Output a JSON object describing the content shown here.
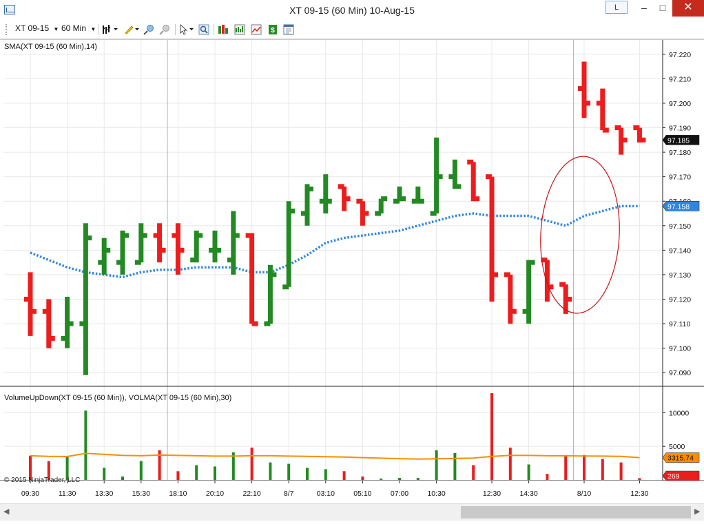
{
  "window": {
    "title": "XT 09-15 (60 Min)  10-Aug-15",
    "link_button_label": "L",
    "minimize_glyph": "–",
    "maximize_glyph": "□",
    "close_glyph": "✕"
  },
  "toolbar": {
    "instrument": "XT 09-15",
    "interval": "60 Min",
    "icons": [
      "bar-type-icon",
      "drawing-pencil-icon",
      "zoom-in-icon",
      "zoom-out-icon",
      "pointer-icon",
      "search-icon",
      "strategies-icon",
      "chart-style-icon",
      "indicators-icon",
      "money-icon",
      "properties-icon"
    ]
  },
  "colors": {
    "up": "#238a23",
    "down": "#ee1c1c",
    "sma": "#2f86e0",
    "volma": "#ff8c00",
    "ellipse": "#cc1111",
    "grid": "#e8e8e8"
  },
  "price_panel": {
    "label": "SMA(XT 09-15 (60 Min),14)",
    "y_ticks": [
      "97.220",
      "97.210",
      "97.200",
      "97.190",
      "97.180",
      "97.170",
      "97.160",
      "97.150",
      "97.140",
      "97.130",
      "97.120",
      "97.110",
      "97.100",
      "97.090"
    ],
    "last_price": "97.185",
    "sma_value": "97.158"
  },
  "volume_panel": {
    "label": "VolumeUpDown(XT 09-15 (60 Min)), VOLMA(XT 09-15 (60 Min),30)",
    "y_ticks": [
      "10000",
      "5000"
    ],
    "volma_value": "3315.74",
    "last_volume": "269"
  },
  "copyright": "© 2015 NinjaTrader, LLC",
  "x_ticks": [
    "09:30",
    "11:30",
    "13:30",
    "15:30",
    "18:10",
    "20:10",
    "22:10",
    "8/7",
    "03:10",
    "05:10",
    "07:00",
    "10:30",
    "12:30",
    "14:30",
    "8/10",
    "12:30"
  ],
  "chart_data": {
    "type": "bar",
    "bars": [
      {
        "dir": "down",
        "open": 97.12,
        "high": 97.131,
        "low": 97.105,
        "close": 97.115
      },
      {
        "dir": "down",
        "open": 97.115,
        "high": 97.12,
        "low": 97.1,
        "close": 97.104
      },
      {
        "dir": "up",
        "open": 97.104,
        "high": 97.121,
        "low": 97.1,
        "close": 97.11
      },
      {
        "dir": "up",
        "open": 97.11,
        "high": 97.151,
        "low": 97.089,
        "close": 97.145
      },
      {
        "dir": "up",
        "open": 97.135,
        "high": 97.145,
        "low": 97.13,
        "close": 97.14
      },
      {
        "dir": "up",
        "open": 97.135,
        "high": 97.148,
        "low": 97.13,
        "close": 97.146
      },
      {
        "dir": "up",
        "open": 97.135,
        "high": 97.151,
        "low": 97.135,
        "close": 97.146
      },
      {
        "dir": "down",
        "open": 97.146,
        "high": 97.151,
        "low": 97.135,
        "close": 97.14
      },
      {
        "dir": "down",
        "open": 97.146,
        "high": 97.151,
        "low": 97.13,
        "close": 97.14
      },
      {
        "dir": "up",
        "open": 97.136,
        "high": 97.148,
        "low": 97.135,
        "close": 97.146
      },
      {
        "dir": "up",
        "open": 97.14,
        "high": 97.148,
        "low": 97.135,
        "close": 97.14
      },
      {
        "dir": "up",
        "open": 97.136,
        "high": 97.156,
        "low": 97.13,
        "close": 97.146
      },
      {
        "dir": "down",
        "open": 97.146,
        "high": 97.147,
        "low": 97.11,
        "close": 97.11
      },
      {
        "dir": "up",
        "open": 97.11,
        "high": 97.134,
        "low": 97.11,
        "close": 97.13
      },
      {
        "dir": "up",
        "open": 97.125,
        "high": 97.16,
        "low": 97.125,
        "close": 97.156
      },
      {
        "dir": "up",
        "open": 97.155,
        "high": 97.167,
        "low": 97.15,
        "close": 97.165
      },
      {
        "dir": "up",
        "open": 97.16,
        "high": 97.171,
        "low": 97.155,
        "close": 97.16
      },
      {
        "dir": "down",
        "open": 97.166,
        "high": 97.166,
        "low": 97.156,
        "close": 97.161
      },
      {
        "dir": "down",
        "open": 97.16,
        "high": 97.16,
        "low": 97.15,
        "close": 97.155
      },
      {
        "dir": "up",
        "open": 97.155,
        "high": 97.161,
        "low": 97.155,
        "close": 97.161
      },
      {
        "dir": "up",
        "open": 97.16,
        "high": 97.166,
        "low": 97.16,
        "close": 97.161
      },
      {
        "dir": "up",
        "open": 97.16,
        "high": 97.166,
        "low": 97.16,
        "close": 97.16
      },
      {
        "dir": "up",
        "open": 97.155,
        "high": 97.186,
        "low": 97.155,
        "close": 97.17
      },
      {
        "dir": "up",
        "open": 97.17,
        "high": 97.177,
        "low": 97.165,
        "close": 97.166
      },
      {
        "dir": "down",
        "open": 97.176,
        "high": 97.176,
        "low": 97.16,
        "close": 97.161
      },
      {
        "dir": "down",
        "open": 97.17,
        "high": 97.17,
        "low": 97.119,
        "close": 97.13
      },
      {
        "dir": "down",
        "open": 97.13,
        "high": 97.13,
        "low": 97.11,
        "close": 97.115
      },
      {
        "dir": "up",
        "open": 97.115,
        "high": 97.136,
        "low": 97.11,
        "close": 97.135
      },
      {
        "dir": "down",
        "open": 97.136,
        "high": 97.136,
        "low": 97.119,
        "close": 97.125
      },
      {
        "dir": "down",
        "open": 97.126,
        "high": 97.126,
        "low": 97.114,
        "close": 97.12
      },
      {
        "dir": "down",
        "open": 97.206,
        "high": 97.217,
        "low": 97.194,
        "close": 97.2
      },
      {
        "dir": "down",
        "open": 97.2,
        "high": 97.206,
        "low": 97.189,
        "close": 97.189
      },
      {
        "dir": "down",
        "open": 97.19,
        "high": 97.19,
        "low": 97.179,
        "close": 97.185
      },
      {
        "dir": "down",
        "open": 97.19,
        "high": 97.19,
        "low": 97.184,
        "close": 97.185
      }
    ],
    "sma": [
      97.139,
      97.136,
      97.133,
      97.131,
      97.13,
      97.129,
      97.131,
      97.132,
      97.132,
      97.133,
      97.133,
      97.133,
      97.131,
      97.131,
      97.134,
      97.138,
      97.143,
      97.145,
      97.146,
      97.147,
      97.148,
      97.15,
      97.152,
      97.154,
      97.155,
      97.154,
      97.154,
      97.154,
      97.152,
      97.15,
      97.154,
      97.156,
      97.158,
      97.158
    ],
    "volume": [
      {
        "dir": "down",
        "v": 3600
      },
      {
        "dir": "down",
        "v": 2800
      },
      {
        "dir": "up",
        "v": 3400
      },
      {
        "dir": "up",
        "v": 10300
      },
      {
        "dir": "up",
        "v": 1800
      },
      {
        "dir": "up",
        "v": 500
      },
      {
        "dir": "up",
        "v": 2800
      },
      {
        "dir": "down",
        "v": 4400
      },
      {
        "dir": "down",
        "v": 1300
      },
      {
        "dir": "up",
        "v": 2200
      },
      {
        "dir": "up",
        "v": 2000
      },
      {
        "dir": "up",
        "v": 4100
      },
      {
        "dir": "down",
        "v": 4800
      },
      {
        "dir": "up",
        "v": 2600
      },
      {
        "dir": "up",
        "v": 2400
      },
      {
        "dir": "up",
        "v": 1800
      },
      {
        "dir": "up",
        "v": 1600
      },
      {
        "dir": "down",
        "v": 1300
      },
      {
        "dir": "down",
        "v": 500
      },
      {
        "dir": "up",
        "v": 200
      },
      {
        "dir": "up",
        "v": 300
      },
      {
        "dir": "up",
        "v": 300
      },
      {
        "dir": "up",
        "v": 4400
      },
      {
        "dir": "up",
        "v": 4000
      },
      {
        "dir": "down",
        "v": 2200
      },
      {
        "dir": "down",
        "v": 12900
      },
      {
        "dir": "down",
        "v": 4800
      },
      {
        "dir": "up",
        "v": 2300
      },
      {
        "dir": "down",
        "v": 900
      },
      {
        "dir": "down",
        "v": 3700
      },
      {
        "dir": "down",
        "v": 3700
      },
      {
        "dir": "down",
        "v": 3100
      },
      {
        "dir": "down",
        "v": 2600
      },
      {
        "dir": "down",
        "v": 269
      }
    ],
    "volma": [
      3600,
      3500,
      3480,
      3950,
      3800,
      3650,
      3600,
      3700,
      3650,
      3600,
      3550,
      3550,
      3600,
      3600,
      3550,
      3500,
      3450,
      3400,
      3320,
      3240,
      3160,
      3100,
      3150,
      3200,
      3250,
      3500,
      3650,
      3650,
      3600,
      3580,
      3560,
      3550,
      3500,
      3315.74
    ],
    "price_range": [
      97.085,
      97.225
    ],
    "volume_range": [
      0,
      13000
    ]
  }
}
